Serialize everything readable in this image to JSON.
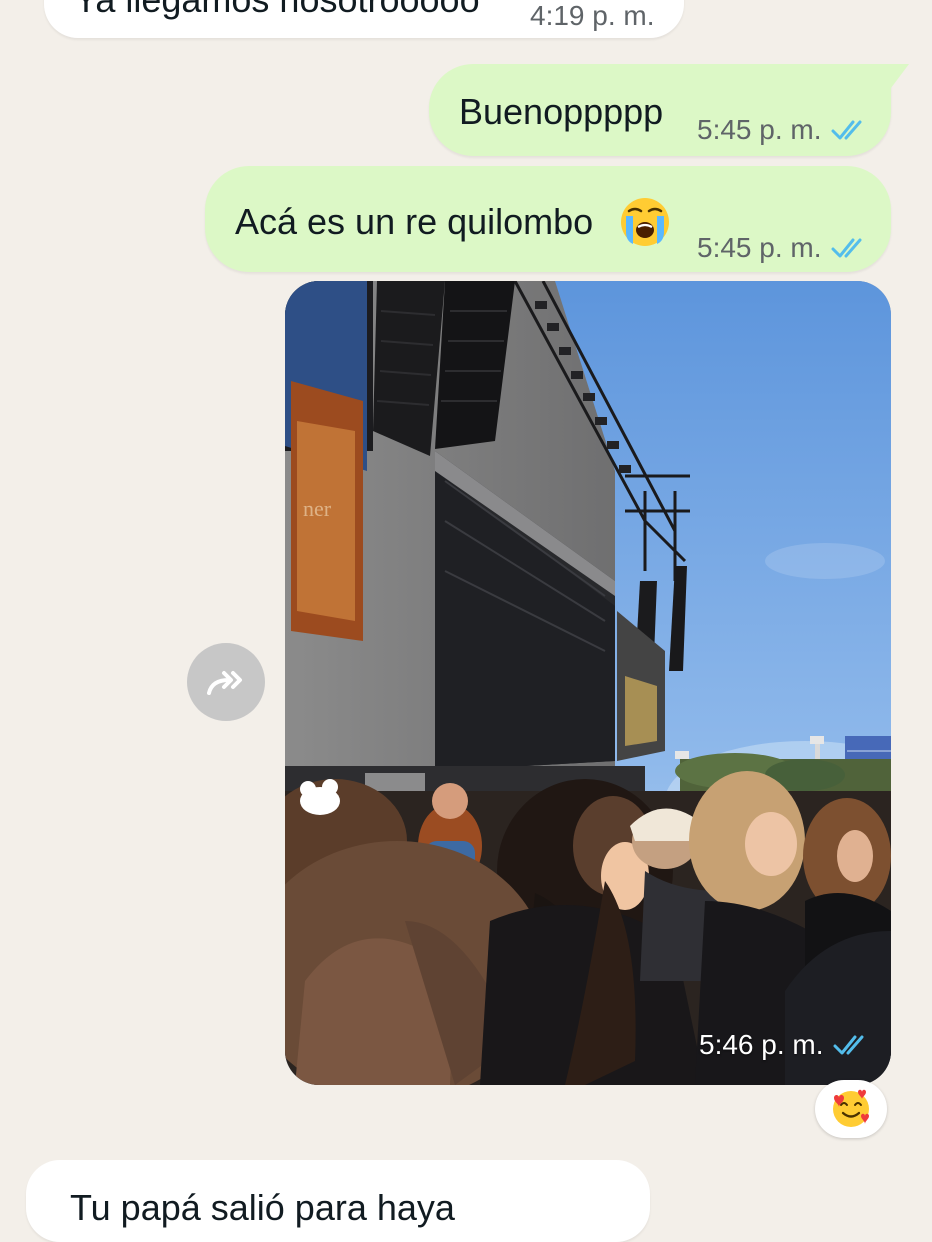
{
  "chat": {
    "messages": [
      {
        "direction": "incoming",
        "text": "Ya llegamos nosotrooooo",
        "time": "4:19 p. m."
      },
      {
        "direction": "outgoing",
        "text": "Buenoppppp",
        "time": "5:45 p. m.",
        "status_icon": "double-check-icon"
      },
      {
        "direction": "outgoing",
        "text": "Acá es un re quilombo",
        "emoji": "loudly-crying-face-emoji",
        "time": "5:45 p. m.",
        "status_icon": "double-check-icon"
      },
      {
        "direction": "outgoing",
        "type": "photo",
        "time": "5:46 p. m.",
        "status_icon": "double-check-icon",
        "reaction": "smiling-face-with-hearts-emoji"
      },
      {
        "direction": "incoming",
        "text": "Tu papá salió para haya"
      }
    ]
  },
  "ui": {
    "forward_icon": "forward-arrow-icon"
  },
  "colors": {
    "background": "#f3efe9",
    "incoming_bubble": "#ffffff",
    "outgoing_bubble": "#dcf8c6",
    "time_text": "#5f6468",
    "read_ticks": "#53bdeb",
    "forward_button": "#c7c7c7"
  }
}
